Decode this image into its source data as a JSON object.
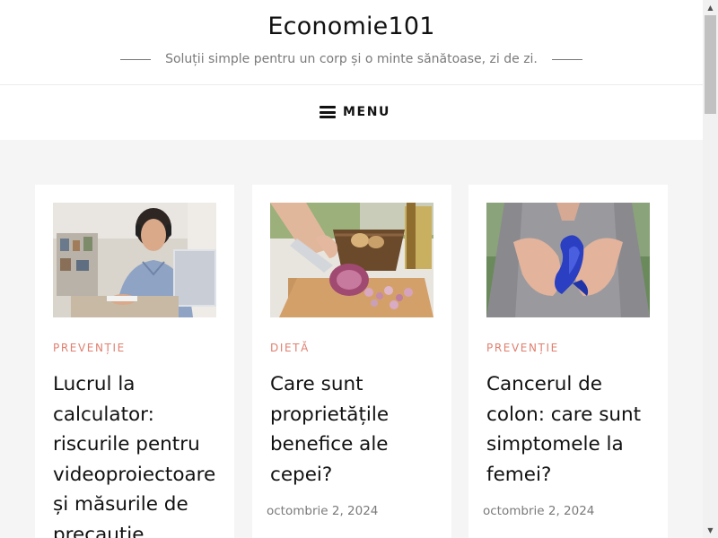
{
  "site": {
    "title": "Economie101",
    "tagline": "Soluții simple pentru un corp și o minte sănătoase, zi de zi."
  },
  "nav": {
    "menu_label": "MENU",
    "menu_icon": "hamburger-icon"
  },
  "posts": [
    {
      "category": "PREVENȚIE",
      "title": "Lucrul la calculator: riscurile pentru videoproiectoare și măsurile de precauție",
      "date": "",
      "image": "woman-with-headphones-at-laptop"
    },
    {
      "category": "DIETĂ",
      "title": "Care sunt proprietățile benefice ale cepei?",
      "date": "octombrie 2, 2024",
      "image": "chopping-red-onion"
    },
    {
      "category": "PREVENȚIE",
      "title": "Cancerul de colon: care sunt simptomele la femei?",
      "date": "octombrie 2, 2024",
      "image": "hands-holding-blue-ribbon"
    }
  ],
  "colors": {
    "category_accent": "#e07f6f",
    "background": "#f5f5f5",
    "card": "#ffffff"
  }
}
